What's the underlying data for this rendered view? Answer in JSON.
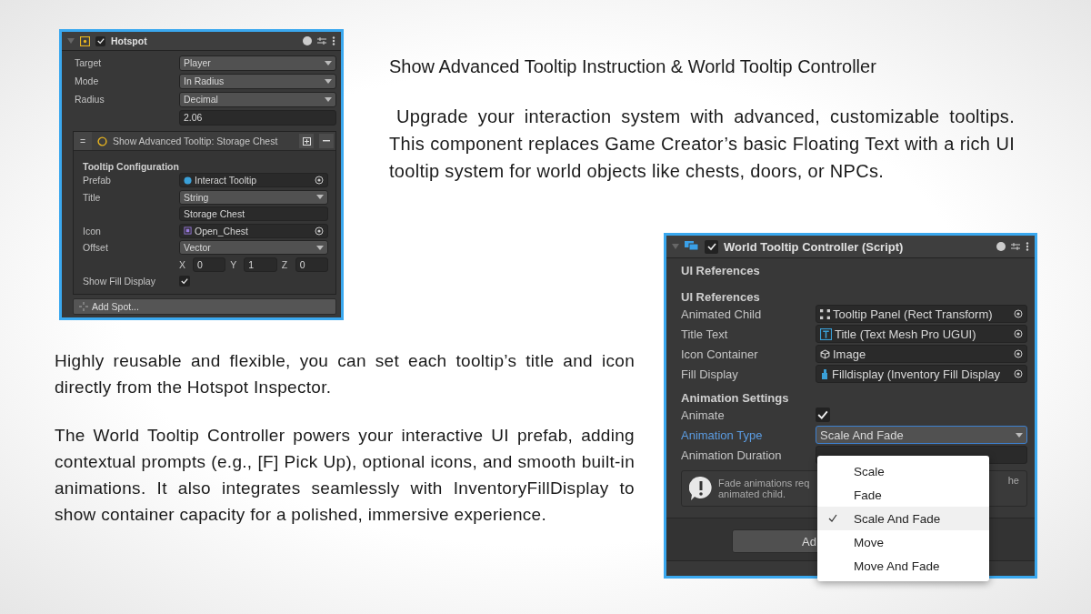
{
  "hotspot": {
    "title": "Hotspot",
    "enabled": true,
    "fields": [
      {
        "label": "Target",
        "kind": "dropdown",
        "value": "Player"
      },
      {
        "label": "Mode",
        "kind": "dropdown",
        "value": "In Radius"
      },
      {
        "label": "Radius",
        "kind": "dropdown",
        "value": "Decimal"
      },
      {
        "kind": "input",
        "value": "2.06"
      }
    ],
    "instruction": {
      "title": "Show Advanced Tooltip: Storage Chest",
      "handle": "=",
      "section": "Tooltip Configuration",
      "fields": [
        {
          "label": "Prefab",
          "kind": "object",
          "value": "Interact Tooltip"
        },
        {
          "label": "Title",
          "kind": "dropdown",
          "value": "String"
        },
        {
          "kind": "input",
          "value": "Storage Chest"
        },
        {
          "label": "Icon",
          "kind": "object",
          "value": "Open_Chest"
        },
        {
          "label": "Offset",
          "kind": "dropdown",
          "value": "Vector"
        },
        {
          "kind": "vector",
          "axes": [
            {
              "axis": "X",
              "value": "0"
            },
            {
              "axis": "Y",
              "value": "1"
            },
            {
              "axis": "Z",
              "value": "0"
            }
          ]
        },
        {
          "label": "Show Fill Display",
          "kind": "checkbox",
          "checked": true
        }
      ]
    },
    "add_button": "Add Spot..."
  },
  "heading": "Show Advanced Tooltip Instruction & World Tooltip Controller",
  "intro": "Upgrade your interaction system with advanced, customizable tooltips. This component replaces Game Creator’s basic Floating Text with a rich UI tooltip system for world objects like chests, doors, or NPCs.",
  "paragraphs": [
    "Highly reusable and flexible, you can set each tooltip’s title and icon directly from the Hotspot Inspector.",
    "The World Tooltip Controller powers your interactive UI prefab, adding contextual prompts (e.g., [F] Pick Up), optional icons, and smooth built-in animations. It also integrates seamlessly with InventoryFillDisplay to show container capacity for a polished, immersive experience."
  ],
  "controller": {
    "title": "World Tooltip Controller (Script)",
    "enabled": true,
    "top_section": "UI References",
    "sections": [
      {
        "title": "UI References",
        "fields": [
          {
            "label": "Animated Child",
            "kind": "object",
            "value": "Tooltip Panel (Rect Transform)"
          },
          {
            "label": "Title Text",
            "kind": "object",
            "value": "Title (Text Mesh Pro UGUI)"
          },
          {
            "label": "Icon Container",
            "kind": "object",
            "value": "Image"
          },
          {
            "label": "Fill Display",
            "kind": "object",
            "value": "Filldisplay (Inventory Fill Display"
          }
        ]
      },
      {
        "title": "Animation Settings",
        "fields": [
          {
            "label": "Animate",
            "kind": "checkbox",
            "checked": true
          },
          {
            "label": "Animation Type",
            "kind": "dropdown",
            "value": "Scale And Fade",
            "focused": true
          },
          {
            "label": "Animation Duration",
            "kind": "input"
          }
        ]
      }
    ],
    "help_text": [
      "Fade animations req",
      "animated child."
    ],
    "help_text_right": "he",
    "add_button": "Ad",
    "dropdown_options": [
      {
        "label": "Scale",
        "selected": false
      },
      {
        "label": "Fade",
        "selected": false
      },
      {
        "label": "Scale And Fade",
        "selected": true
      },
      {
        "label": "Move",
        "selected": false
      },
      {
        "label": "Move And Fade",
        "selected": false
      }
    ]
  }
}
